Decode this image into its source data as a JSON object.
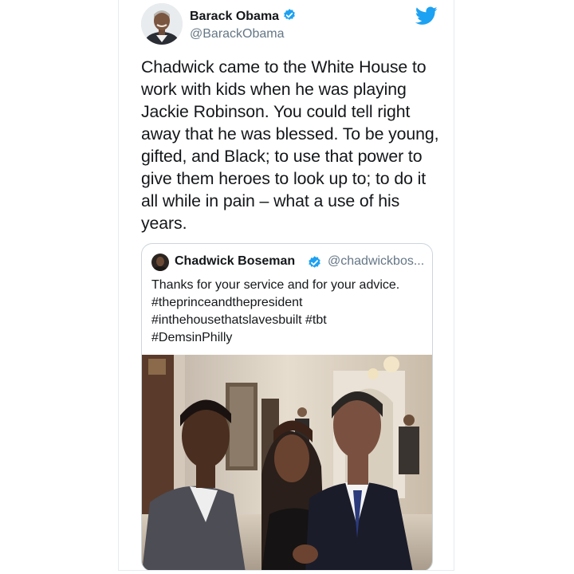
{
  "tweet": {
    "author_name": "Barack Obama",
    "author_handle": "@BarackObama",
    "text": "Chadwick came to the White House to work with kids when he was playing Jackie Robinson. You could tell right away that he was blessed. To be young, gifted, and Black; to use that power to give them heroes to look up to; to do it all while in pain – what a use of his years."
  },
  "quoted_tweet": {
    "author_name": "Chadwick Boseman",
    "author_handle": "@chadwickbos...",
    "lines": [
      "Thanks for your service and for your advice.",
      "#theprinceandthepresident",
      "#inthehousethatslavesbuilt #tbt",
      "#DemsinPhilly"
    ]
  },
  "icons": {
    "verified": "verified-badge-icon",
    "brand": "twitter-bird-icon"
  },
  "colors": {
    "twitter_blue": "#1da1f2",
    "text_primary": "#14171a",
    "text_secondary": "#657786",
    "border": "#ccd6dd"
  }
}
